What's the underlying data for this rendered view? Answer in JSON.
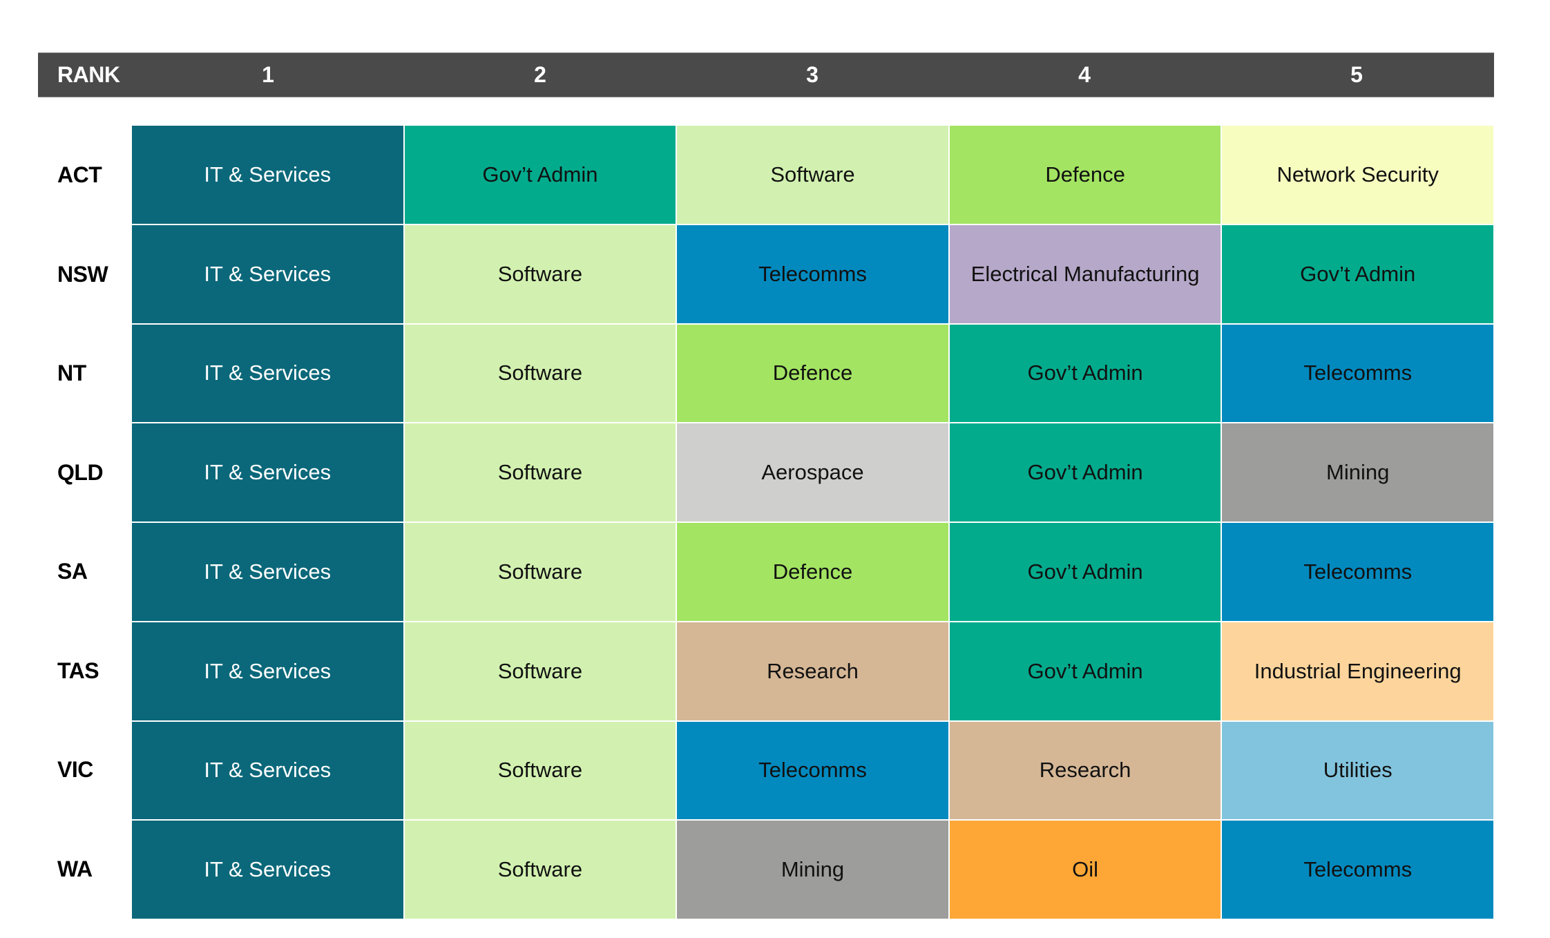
{
  "chart_data": {
    "type": "table",
    "title": "",
    "header": {
      "corner_label": "RANK",
      "ranks": [
        "1",
        "2",
        "3",
        "4",
        "5"
      ]
    },
    "rows": [
      {
        "state": "ACT",
        "industries": [
          "IT & Services",
          "Gov’t Admin",
          "Software",
          "Defence",
          "Network Security"
        ]
      },
      {
        "state": "NSW",
        "industries": [
          "IT & Services",
          "Software",
          "Telecomms",
          "Electrical Manufacturing",
          "Gov’t Admin"
        ]
      },
      {
        "state": "NT",
        "industries": [
          "IT & Services",
          "Software",
          "Defence",
          "Gov’t Admin",
          "Telecomms"
        ]
      },
      {
        "state": "QLD",
        "industries": [
          "IT & Services",
          "Software",
          "Aerospace",
          "Gov’t Admin",
          "Mining"
        ]
      },
      {
        "state": "SA",
        "industries": [
          "IT & Services",
          "Software",
          "Defence",
          "Gov’t Admin",
          "Telecomms"
        ]
      },
      {
        "state": "TAS",
        "industries": [
          "IT & Services",
          "Software",
          "Research",
          "Gov’t Admin",
          "Industrial Engineering"
        ]
      },
      {
        "state": "VIC",
        "industries": [
          "IT & Services",
          "Software",
          "Telecomms",
          "Research",
          "Utilities"
        ]
      },
      {
        "state": "WA",
        "industries": [
          "IT & Services",
          "Software",
          "Mining",
          "Oil",
          "Telecomms"
        ]
      }
    ],
    "industry_colors": {
      "IT & Services": "#0b687a",
      "Gov’t Admin": "#03ab8d",
      "Software": "#d2f1b0",
      "Defence": "#a3e462",
      "Network Security": "#f6fdbf",
      "Telecomms": "#028abf",
      "Electrical Manufacturing": "#b6a8c9",
      "Aerospace": "#cfcfcd",
      "Mining": "#9d9d9b",
      "Research": "#d5b796",
      "Industrial Engineering": "#fdd59c",
      "Utilities": "#82c4de",
      "Oil": "#fea737"
    },
    "light_text_industries": [
      "IT & Services"
    ],
    "header_color": "#4a4a4a"
  }
}
